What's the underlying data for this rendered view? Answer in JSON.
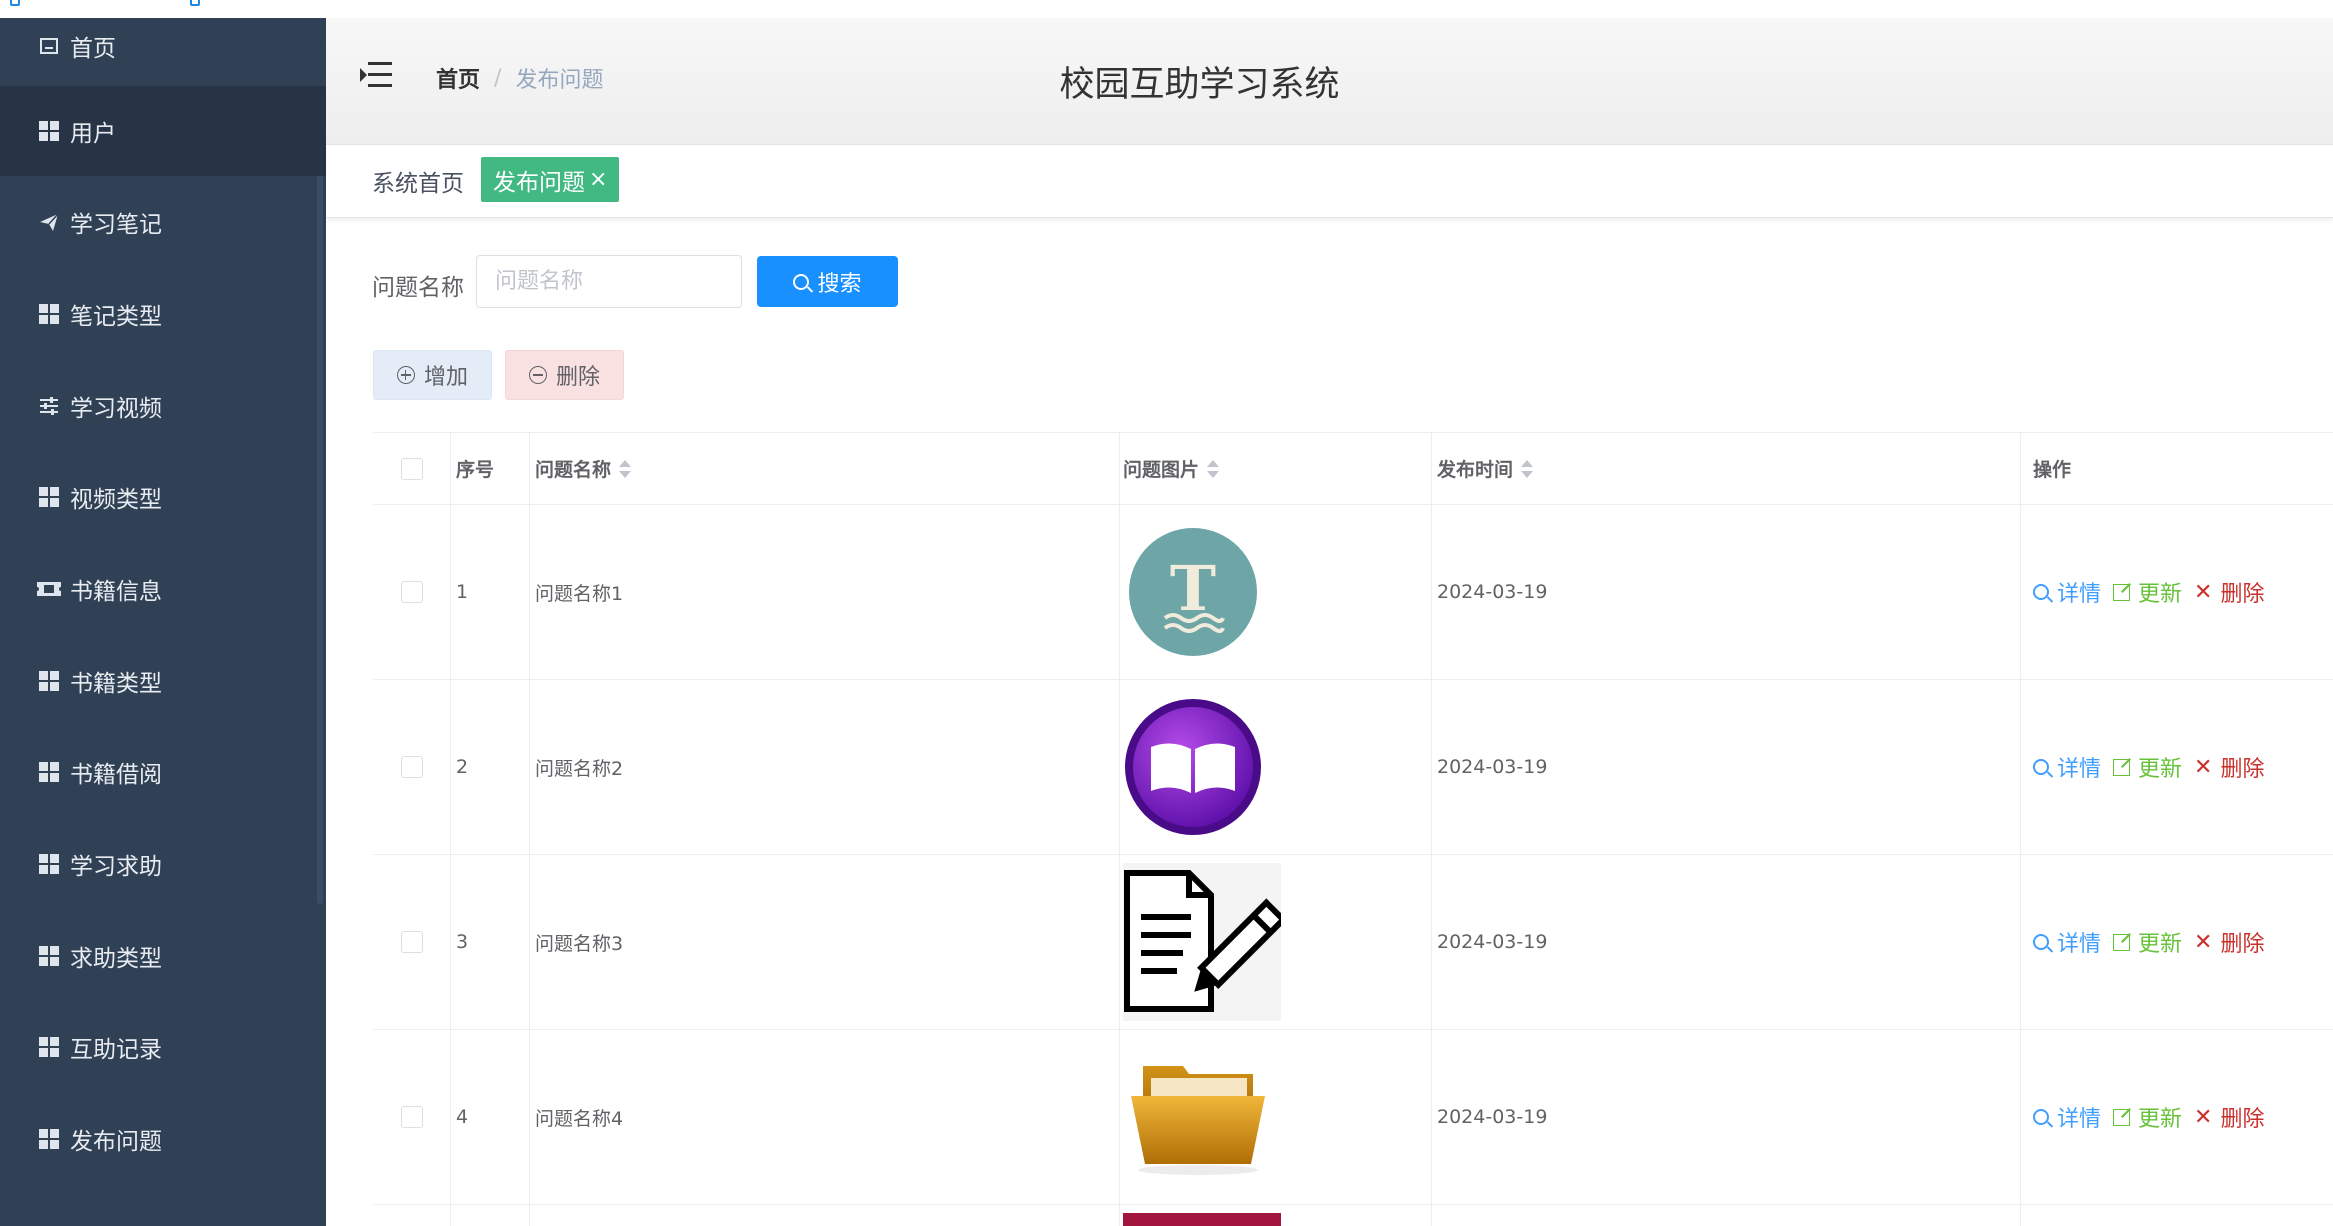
{
  "app": {
    "title": "校园互助学习系统"
  },
  "breadcrumb": {
    "home": "首页",
    "separator": "/",
    "current": "发布问题"
  },
  "sidebar": {
    "items": [
      {
        "label": "首页",
        "icon": "home-icon"
      },
      {
        "label": "用户",
        "icon": "grid-icon",
        "active": true
      },
      {
        "label": "学习笔记",
        "icon": "paper-plane-icon"
      },
      {
        "label": "笔记类型",
        "icon": "grid-icon"
      },
      {
        "label": "学习视频",
        "icon": "sliders-icon"
      },
      {
        "label": "视频类型",
        "icon": "grid-icon"
      },
      {
        "label": "书籍信息",
        "icon": "ticket-icon"
      },
      {
        "label": "书籍类型",
        "icon": "grid-icon"
      },
      {
        "label": "书籍借阅",
        "icon": "grid-icon"
      },
      {
        "label": "学习求助",
        "icon": "grid-icon"
      },
      {
        "label": "求助类型",
        "icon": "grid-icon"
      },
      {
        "label": "互助记录",
        "icon": "grid-icon"
      },
      {
        "label": "发布问题",
        "icon": "grid-icon"
      }
    ]
  },
  "tags": {
    "home": "系统首页",
    "active": "发布问题",
    "close": "×"
  },
  "search": {
    "label": "问题名称",
    "placeholder": "问题名称",
    "value": "",
    "button": "搜索"
  },
  "actions": {
    "add": "增加",
    "delete": "删除"
  },
  "table": {
    "headers": {
      "index": "序号",
      "name": "问题名称",
      "image": "问题图片",
      "time": "发布时间",
      "ops": "操作"
    },
    "ops": {
      "detail": "详情",
      "update": "更新",
      "delete": "删除"
    },
    "rows": [
      {
        "index": "1",
        "name": "问题名称1",
        "image": "letter-t-wave-icon",
        "time": "2024-03-19"
      },
      {
        "index": "2",
        "name": "问题名称2",
        "image": "open-book-icon",
        "time": "2024-03-19"
      },
      {
        "index": "3",
        "name": "问题名称3",
        "image": "document-pencil-icon",
        "time": "2024-03-19"
      },
      {
        "index": "4",
        "name": "问题名称4",
        "image": "open-folder-icon",
        "time": "2024-03-19"
      }
    ]
  },
  "colors": {
    "sidebar_bg": "#304156",
    "sidebar_active_bg": "#263445",
    "tag_active": "#42b983",
    "primary": "#1890ff",
    "detail": "#409eff",
    "update": "#67c23a",
    "delete": "#c9302c"
  }
}
